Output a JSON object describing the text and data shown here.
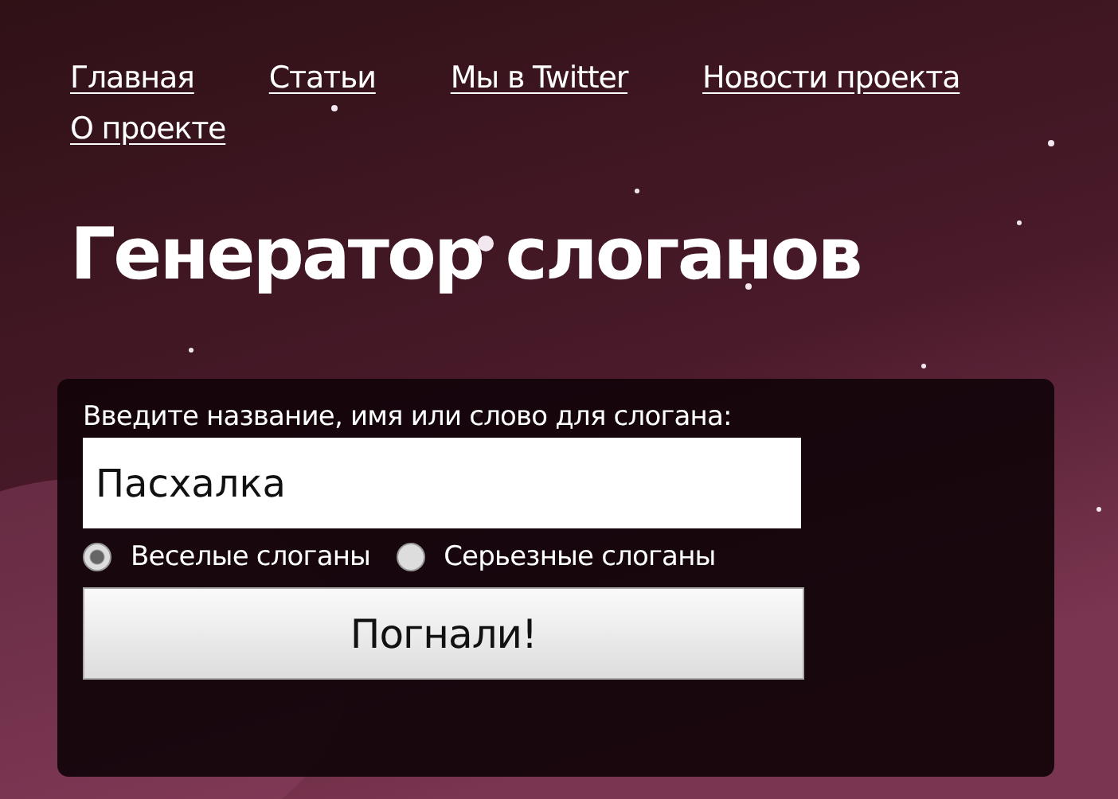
{
  "nav": [
    {
      "label": "Главная"
    },
    {
      "label": "Статьи"
    },
    {
      "label": "Мы в Twitter"
    },
    {
      "label": "Новости проекта"
    },
    {
      "label": "О проекте"
    }
  ],
  "title": "Генератор слоганов",
  "form": {
    "label": "Введите название, имя или слово для слогана:",
    "value": "Пасхалка",
    "options": [
      {
        "label": "Веселые слоганы",
        "selected": true
      },
      {
        "label": "Серьезные слоганы",
        "selected": false
      }
    ],
    "button": "Погнали!"
  }
}
